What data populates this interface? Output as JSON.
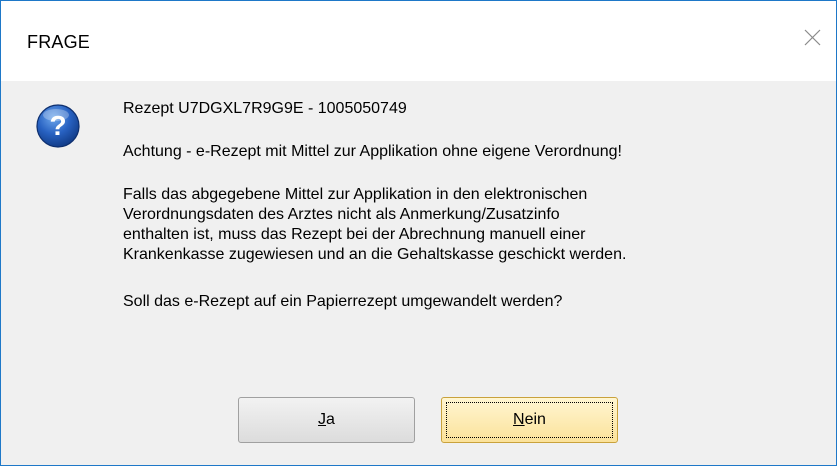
{
  "window": {
    "title": "FRAGE",
    "close_label": "Close"
  },
  "message": {
    "icon": "question-icon",
    "heading": "Rezept U7DGXL7R9G9E - 1005050749",
    "warning": "Achtung - e-Rezept mit Mittel zur Applikation ohne eigene Verordnung!",
    "body": "Falls das abgegebene Mittel zur Applikation in den elektronischen\nVerordnungsdaten des Arztes nicht als Anmerkung/Zusatzinfo\nenthalten ist, muss das Rezept bei der Abrechnung manuell einer\nKrankenkasse zugewiesen und an die Gehaltskasse geschickt werden.",
    "question": "Soll das e-Rezept auf ein Papierrezept umgewandelt werden?"
  },
  "buttons": {
    "yes": {
      "mnemonic": "J",
      "rest": "a"
    },
    "no": {
      "mnemonic": "N",
      "rest": "ein"
    }
  },
  "colors": {
    "window_border": "#1e78c8",
    "icon_blue": "#1e5ab4",
    "default_button": "#fbe29a"
  }
}
